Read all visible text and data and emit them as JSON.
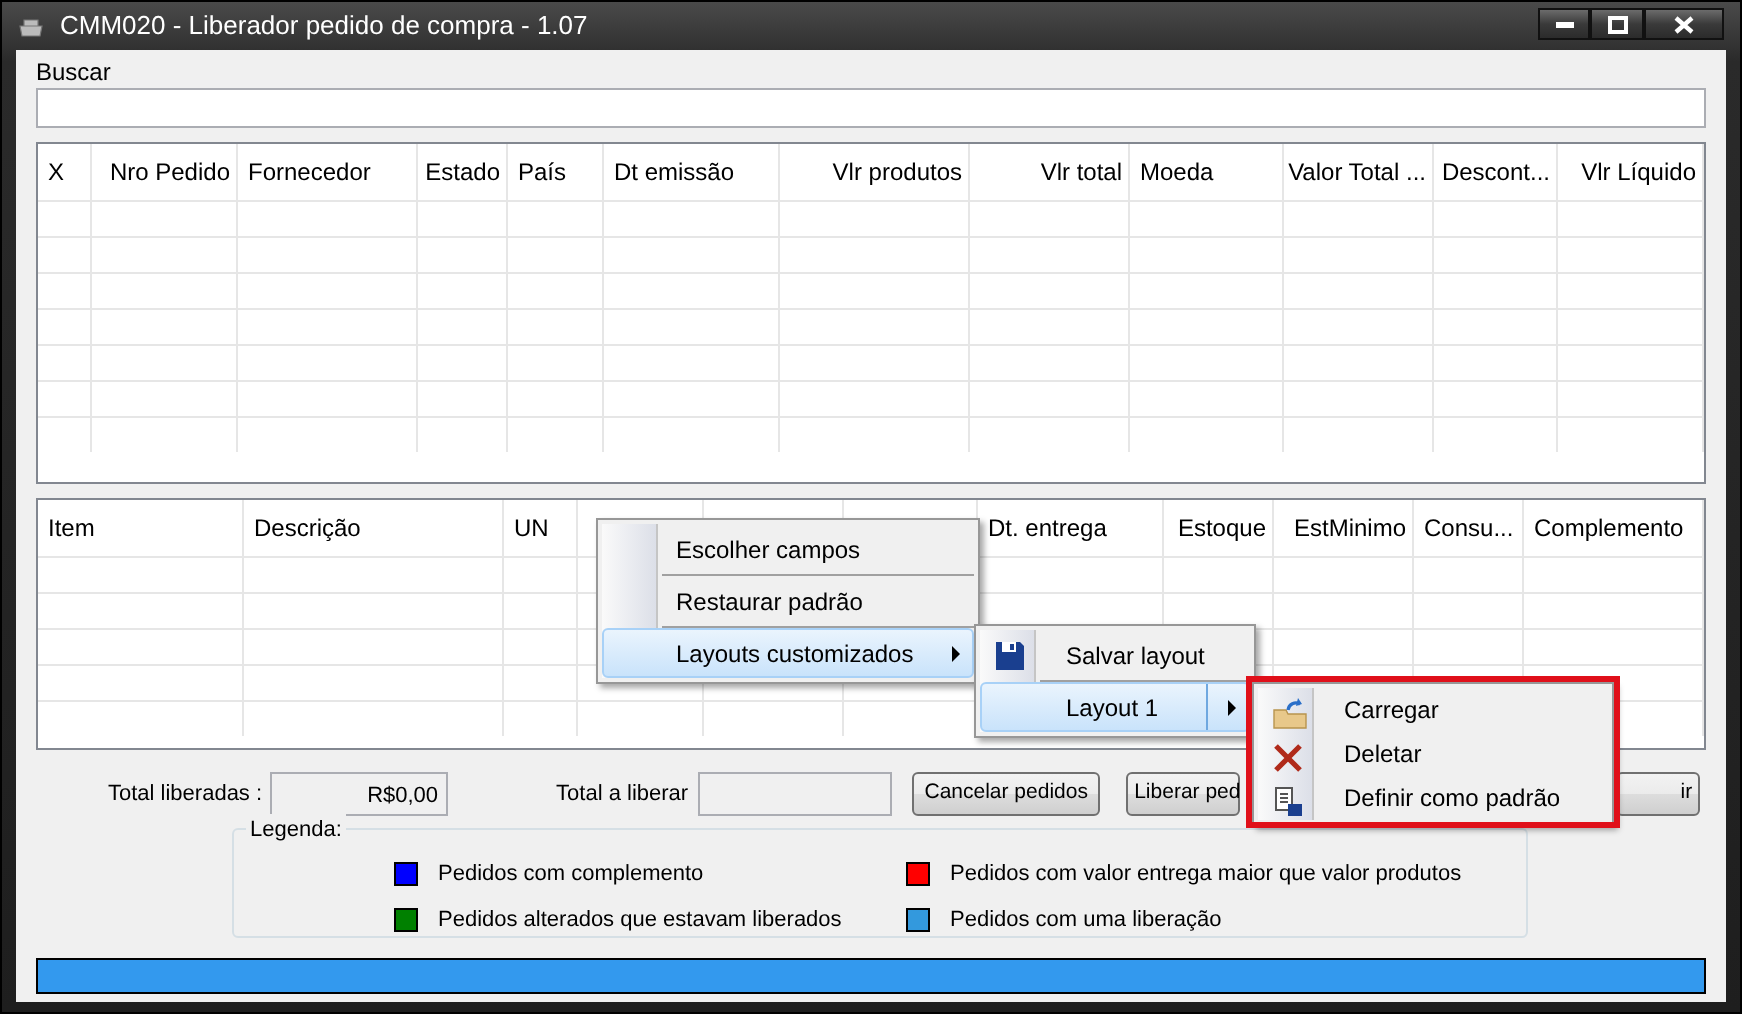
{
  "window": {
    "title": "CMM020 - Liberador pedido de compra - 1.07"
  },
  "search": {
    "label": "Buscar"
  },
  "orders_table": {
    "columns": [
      {
        "label": "X",
        "right_aligned": false
      },
      {
        "label": "Nro Pedido",
        "right_aligned": true
      },
      {
        "label": "Fornecedor",
        "right_aligned": false
      },
      {
        "label": "Estado",
        "right_aligned": true
      },
      {
        "label": "País",
        "right_aligned": false
      },
      {
        "label": "Dt emissão",
        "right_aligned": false
      },
      {
        "label": "Vlr produtos",
        "right_aligned": true
      },
      {
        "label": "Vlr total",
        "right_aligned": true
      },
      {
        "label": "Moeda",
        "right_aligned": false
      },
      {
        "label": "Valor Total ...",
        "right_aligned": true
      },
      {
        "label": "Descont...",
        "right_aligned": true
      },
      {
        "label": "Vlr Líquido",
        "right_aligned": true
      }
    ]
  },
  "items_table": {
    "columns": [
      {
        "label": "Item",
        "right_aligned": false
      },
      {
        "label": "Descrição",
        "right_aligned": false
      },
      {
        "label": "UN",
        "right_aligned": false
      },
      {
        "label": "Dt. entrega",
        "right_aligned": false
      },
      {
        "label": "Estoque",
        "right_aligned": true
      },
      {
        "label": "EstMinimo",
        "right_aligned": true
      },
      {
        "label": "Consu...",
        "right_aligned": false
      },
      {
        "label": "Complemento",
        "right_aligned": false
      }
    ]
  },
  "totals": {
    "released_label": "Total liberadas :",
    "released_value": "R$0,00",
    "to_release_label": "Total a liberar"
  },
  "buttons": [
    "Cancelar pedidos",
    "Liberar ped",
    "ir"
  ],
  "legend": {
    "title": "Legenda:",
    "items": [
      {
        "label": "Pedidos com complemento",
        "color": "#0000ff"
      },
      {
        "label": "Pedidos com valor entrega maior que valor produtos",
        "color": "#ff0000"
      },
      {
        "label": "Pedidos alterados que estavam liberados",
        "color": "#008000"
      },
      {
        "label": "Pedidos com uma liberação",
        "color": "#3399dd"
      }
    ]
  },
  "progress": {
    "level": 1
  },
  "context_menu": {
    "items": [
      {
        "label": "Escolher campos",
        "selected": false,
        "submenu": false
      },
      {
        "label": "Restaurar padrão",
        "selected": false,
        "submenu": false
      },
      {
        "label": "Layouts customizados",
        "selected": true,
        "submenu": true
      }
    ]
  },
  "layouts_menu": {
    "items": [
      {
        "label": "Salvar layout",
        "kind": "save",
        "selected": false,
        "submenu": false
      },
      {
        "label": "Layout 1",
        "kind": "plain",
        "selected": true,
        "submenu": true
      }
    ]
  },
  "layout_actions_menu": {
    "highlighted": true,
    "items": [
      {
        "label": "Carregar",
        "kind": "load"
      },
      {
        "label": "Deletar",
        "kind": "delete"
      },
      {
        "label": "Definir como padrão",
        "kind": "default"
      }
    ]
  }
}
